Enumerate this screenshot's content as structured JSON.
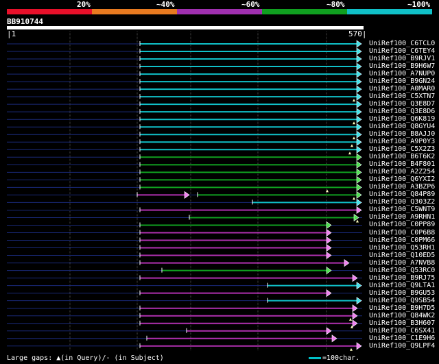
{
  "legend": {
    "colors": [
      "#e8102a",
      "#e87a20",
      "#a030b0",
      "#10a020",
      "#10c0c8"
    ],
    "labels": [
      "20%",
      "~40%",
      "~60%",
      "~80%",
      "~100%"
    ]
  },
  "query": {
    "id": "BB910744",
    "start": "1",
    "end": "570"
  },
  "hits": [
    {
      "name": "UniRef100_C6TCL0",
      "color": "cyan"
    },
    {
      "name": "UniRef100_C6TEY4",
      "color": "cyan"
    },
    {
      "name": "UniRef100_B9RJV1",
      "color": "cyan"
    },
    {
      "name": "UniRef100_B9H6W7",
      "color": "cyan"
    },
    {
      "name": "UniRef100_A7NUP0",
      "color": "cyan"
    },
    {
      "name": "UniRef100_B9GN24",
      "color": "cyan"
    },
    {
      "name": "UniRef100_A0MAR0",
      "color": "cyan"
    },
    {
      "name": "UniRef100_C5XTN7",
      "color": "cyan"
    },
    {
      "name": "UniRef100_Q3E8D7",
      "color": "cyan"
    },
    {
      "name": "UniRef100_Q3E8D6",
      "color": "cyan"
    },
    {
      "name": "UniRef100_Q6K819",
      "color": "cyan"
    },
    {
      "name": "UniRef100_Q8GYU4",
      "color": "cyan"
    },
    {
      "name": "UniRef100_B8AJJ0",
      "color": "cyan"
    },
    {
      "name": "UniRef100_A9P0Y3",
      "color": "cyan"
    },
    {
      "name": "UniRef100_C5X2Z3",
      "color": "cyan"
    },
    {
      "name": "UniRef100_B6T6K2",
      "color": "green"
    },
    {
      "name": "UniRef100_B4F801",
      "color": "green"
    },
    {
      "name": "UniRef100_A2Z254",
      "color": "green"
    },
    {
      "name": "UniRef100_Q6YXI2",
      "color": "green"
    },
    {
      "name": "UniRef100_A3BZP6",
      "color": "green"
    },
    {
      "name": "UniRef100_Q84P89",
      "color": "mixed"
    },
    {
      "name": "UniRef100_Q303Z2",
      "color": "cyan"
    },
    {
      "name": "UniRef100_C5WNT9",
      "color": "magenta"
    },
    {
      "name": "UniRef100_A9RHN1",
      "color": "green"
    },
    {
      "name": "UniRef100_C0PP89",
      "color": "green"
    },
    {
      "name": "UniRef100_C0P6B8",
      "color": "magenta"
    },
    {
      "name": "UniRef100_C0PM66",
      "color": "magenta"
    },
    {
      "name": "UniRef100_Q53RH1",
      "color": "magenta"
    },
    {
      "name": "UniRef100_Q10ED5",
      "color": "magenta"
    },
    {
      "name": "UniRef100_A7NVB8",
      "color": "magenta"
    },
    {
      "name": "UniRef100_Q53RC0",
      "color": "green"
    },
    {
      "name": "UniRef100_B9RJ75",
      "color": "magenta"
    },
    {
      "name": "UniRef100_Q9LTA1",
      "color": "cyan"
    },
    {
      "name": "UniRef100_B9GU53",
      "color": "magenta"
    },
    {
      "name": "UniRef100_Q9SB54",
      "color": "cyan"
    },
    {
      "name": "UniRef100_B9H7D5",
      "color": "magenta"
    },
    {
      "name": "UniRef100_Q84WK2",
      "color": "magenta"
    },
    {
      "name": "UniRef100_B3H607",
      "color": "magenta"
    },
    {
      "name": "UniRef100_C6SX41",
      "color": "magenta"
    },
    {
      "name": "UniRef100_C1E9H6",
      "color": "magenta"
    },
    {
      "name": "UniRef100_Q9LPF4",
      "color": "magenta"
    }
  ],
  "footer": {
    "gaps_text": "Large gaps: ▲(in Query)/- (in Subject)",
    "scale_text": "=100char."
  },
  "palette": {
    "cyan": "#10c0c8",
    "green": "#10a020",
    "magenta": "#b030b0",
    "arrow_cyan": "#40e0e8",
    "arrow_green": "#50e050",
    "arrow_magenta": "#f080f0",
    "track": "#1a2a7a",
    "grid": "#4a4a4a"
  }
}
